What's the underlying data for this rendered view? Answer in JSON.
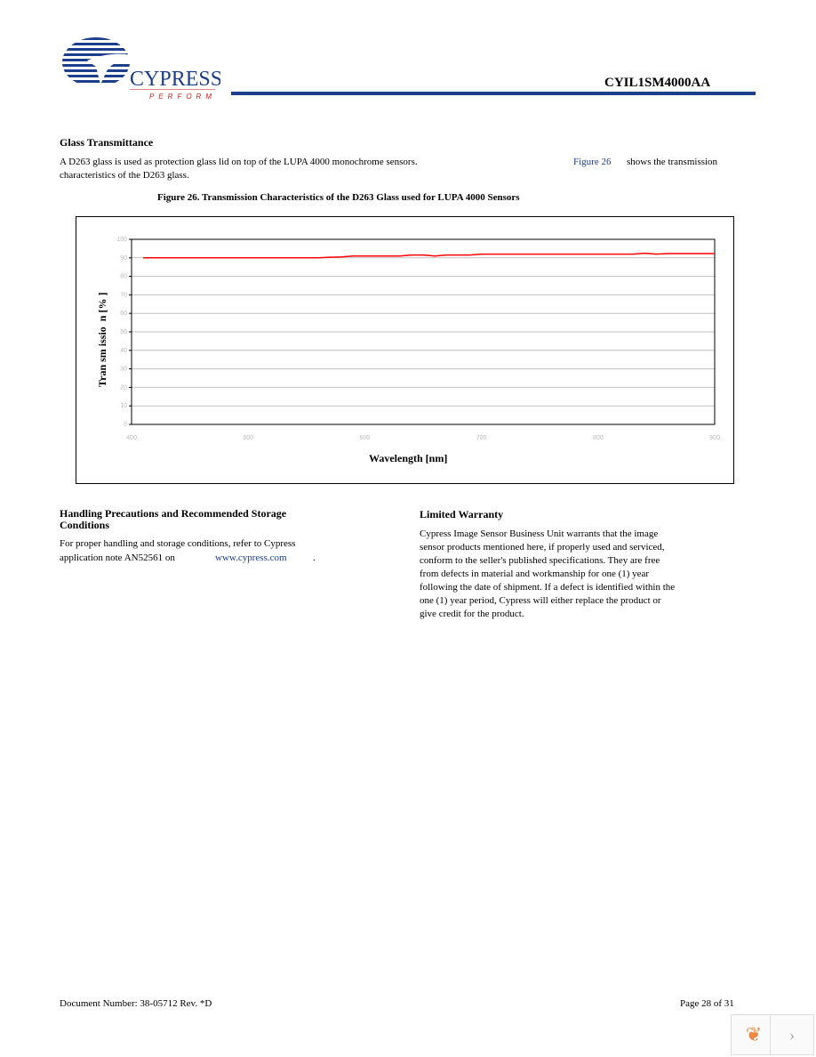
{
  "header": {
    "logo_text": "CYPRESS",
    "logo_tagline": "PERFORM",
    "doc_id": "CYIL1SM4000AA"
  },
  "glass": {
    "heading": "Glass Transmittance",
    "text1": "A D263 glass is used as protection glass lid on top of the LUPA 4000 monochrome sensors.",
    "link": "Figure 26",
    "text2": "shows the transmission",
    "text3": "characteristics of the D263 glass."
  },
  "figure": {
    "caption": "Figure 26.  Transmission Characteristics of the D263 Glass used for LUPA 4000 Sensors"
  },
  "chart_data": {
    "type": "line",
    "xlabel": "Wavelength [nm]",
    "ylabel": "Tran sm issio  n [% ]",
    "xlim": [
      400,
      900
    ],
    "ylim": [
      0,
      100
    ],
    "xticks": [
      400,
      500,
      600,
      700,
      800,
      900
    ],
    "yticks": [
      0,
      10,
      20,
      30,
      40,
      50,
      60,
      70,
      80,
      90,
      100
    ],
    "grid": "horizontal",
    "color": "#ff0000",
    "x": [
      410,
      560,
      570,
      580,
      590,
      600,
      630,
      640,
      650,
      655,
      660,
      670,
      690,
      700,
      830,
      840,
      850,
      860,
      900
    ],
    "y": [
      90,
      90,
      90.3,
      90.5,
      91,
      91,
      91,
      91.5,
      91.5,
      91.3,
      91,
      91.5,
      91.5,
      92,
      92,
      92.5,
      92,
      92.3,
      92.3
    ]
  },
  "handling": {
    "heading1": "Handling Precautions and Recommended Storage",
    "heading2": "Conditions",
    "line1": "For proper handling and storage conditions, refer to Cypress",
    "line2": "application note AN52561 on",
    "link": "www.cypress.com",
    "end": "."
  },
  "warranty": {
    "heading": "Limited Warranty",
    "lines": [
      "Cypress Image Sensor Business Unit warrants that the image",
      "sensor products mentioned here, if properly used and serviced,",
      "conform to the seller's published specifications. They are free",
      "from defects in material and workmanship for one (1) year",
      "following the date of shipment. If a defect is identified within the",
      "one (1) year period, Cypress will either replace the product or",
      "give credit for the product."
    ]
  },
  "footer": {
    "doc_number": "Document Number: 38-05712  Rev. *D",
    "page": "Page 28 of 31"
  }
}
